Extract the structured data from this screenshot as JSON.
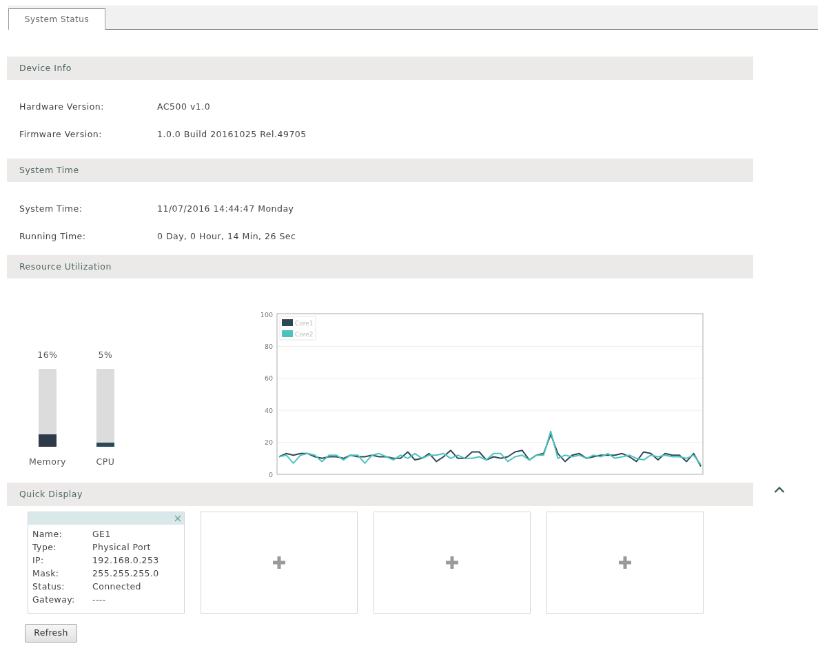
{
  "tabs": [
    {
      "label": "System Status",
      "selected": true
    }
  ],
  "sections": [
    {
      "kind": "info",
      "title": "Device Info",
      "rows": [
        {
          "label": "Hardware Version:",
          "value": "AC500 v1.0"
        },
        {
          "label": "Firmware Version:",
          "value": "1.0.0 Build 20161025 Rel.49705"
        }
      ]
    },
    {
      "kind": "info",
      "title": "System Time",
      "rows": [
        {
          "label": "System Time:",
          "value": "11/07/2016 14:44:47 Monday"
        },
        {
          "label": "Running Time:",
          "value": "0 Day, 0 Hour, 14 Min, 26 Sec"
        }
      ]
    },
    {
      "kind": "resources",
      "title": "Resource Utilization",
      "meters": [
        {
          "label": "Memory",
          "reading": "16%",
          "level": 0.16
        },
        {
          "label": "CPU",
          "reading": "5%",
          "level": 0.05
        }
      ],
      "chart_data": {
        "type": "line",
        "ylim": [
          0,
          100
        ],
        "yticks": [
          0,
          20,
          40,
          60,
          80,
          100
        ],
        "grid": true,
        "legend": true,
        "series": [
          {
            "name": "Core1",
            "color": "#2b4a55",
            "values": [
              11,
              13,
              12,
              13,
              13,
              11,
              10,
              11,
              11,
              10,
              12,
              11,
              11,
              12,
              11,
              11,
              10,
              10,
              14,
              9,
              10,
              13,
              8,
              11,
              15,
              10,
              10,
              14,
              14,
              9,
              11,
              10,
              11,
              14,
              15,
              9,
              12,
              13,
              25,
              13,
              8,
              12,
              13,
              10,
              11,
              12,
              12,
              12,
              13,
              11,
              8,
              14,
              13,
              9,
              13,
              12,
              12,
              8,
              13,
              5
            ]
          },
          {
            "name": "Core2",
            "color": "#4cc3be",
            "values": [
              11,
              12,
              7,
              12,
              13,
              12,
              8,
              12,
              12,
              9,
              12,
              12,
              7,
              12,
              13,
              11,
              9,
              12,
              10,
              13,
              10,
              12,
              12,
              13,
              10,
              12,
              10,
              10,
              11,
              9,
              13,
              13,
              8,
              11,
              12,
              9,
              12,
              12,
              27,
              10,
              12,
              11,
              12,
              10,
              12,
              11,
              13,
              10,
              11,
              12,
              10,
              9,
              12,
              11,
              12,
              11,
              11,
              10,
              12,
              6
            ]
          }
        ]
      }
    },
    {
      "kind": "quick",
      "title": "Quick Display",
      "cards": [
        {
          "kind": "port",
          "fields": [
            {
              "label": "Name:",
              "value": "GE1"
            },
            {
              "label": "Type:",
              "value": "Physical Port"
            },
            {
              "label": "IP:",
              "value": "192.168.0.253"
            },
            {
              "label": "Mask:",
              "value": "255.255.255.0"
            },
            {
              "label": "Status:",
              "value": "Connected"
            },
            {
              "label": "Gateway:",
              "value": "----"
            }
          ]
        },
        {
          "kind": "empty"
        },
        {
          "kind": "empty"
        },
        {
          "kind": "empty"
        }
      ],
      "refresh": "Refresh"
    }
  ]
}
